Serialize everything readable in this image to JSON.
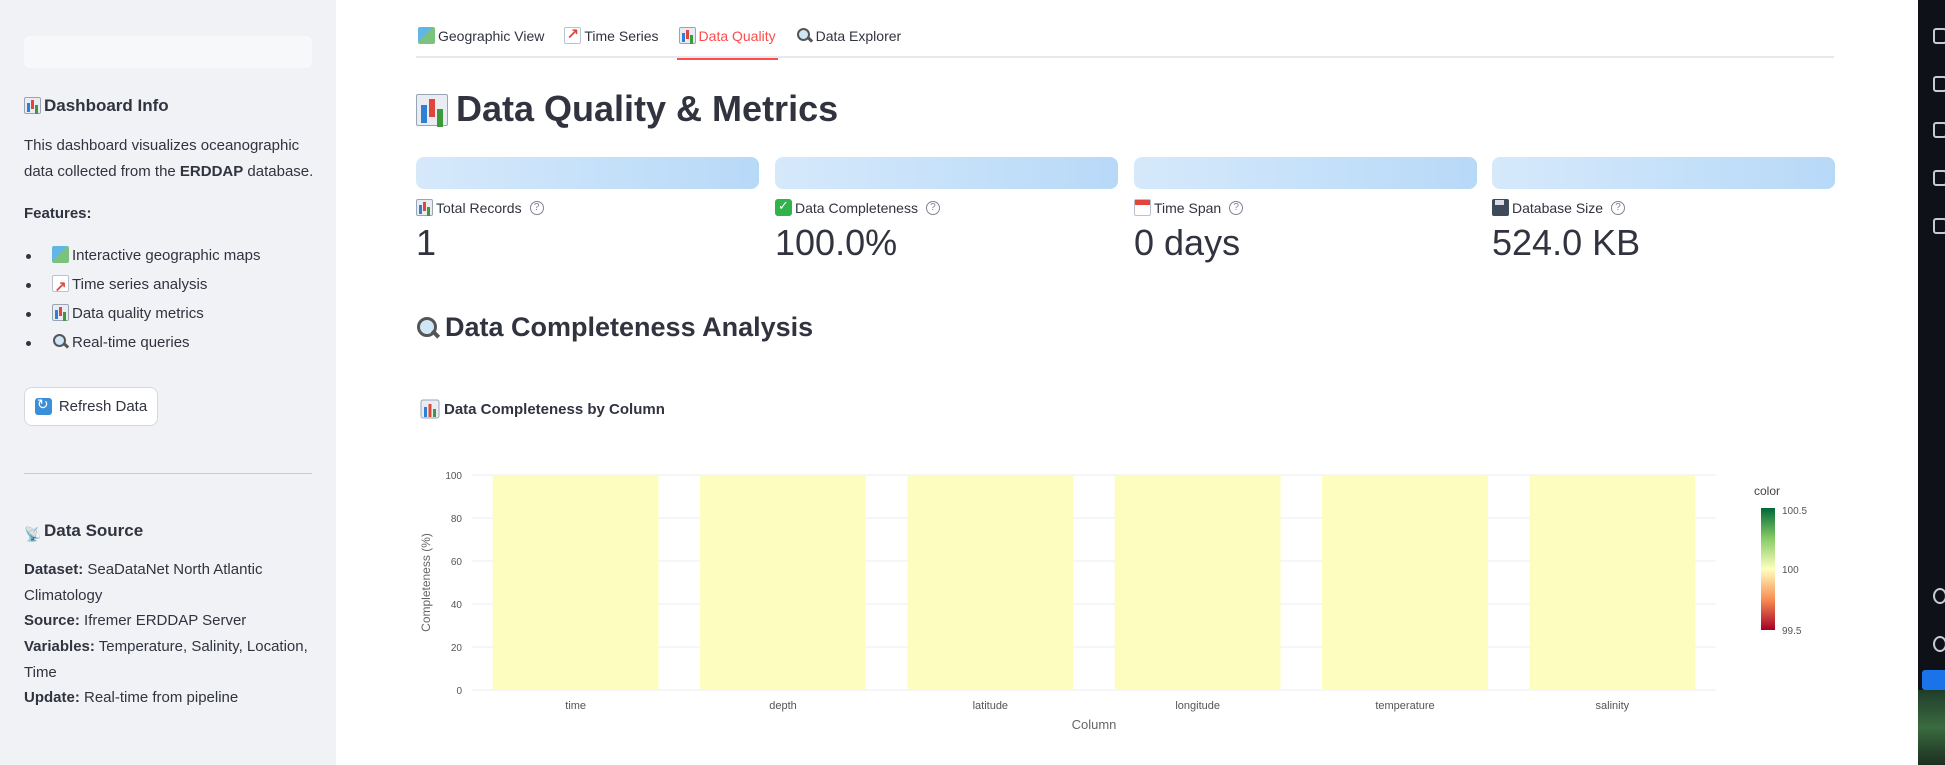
{
  "sidebar": {
    "info_title": "Dashboard Info",
    "info_text_1": "This dashboard visualizes oceanographic data collected from the ",
    "info_text_bold": "ERDDAP",
    "info_text_2": " database.",
    "features_label": "Features:",
    "features": [
      {
        "icon": "map-icon",
        "label": "Interactive geographic maps"
      },
      {
        "icon": "chart-increasing-icon",
        "label": "Time series analysis"
      },
      {
        "icon": "bar-chart-icon",
        "label": "Data quality metrics"
      },
      {
        "icon": "magnifier-icon",
        "label": "Real-time queries"
      }
    ],
    "refresh_button": "Refresh Data",
    "source_title": "Data Source",
    "source": {
      "dataset_label": "Dataset:",
      "dataset_value": " SeaDataNet North Atlantic Climatology",
      "source_label": "Source:",
      "source_value": " Ifremer ERDDAP Server",
      "variables_label": "Variables:",
      "variables_value": " Temperature, Salinity, Location, Time",
      "update_label": "Update:",
      "update_value": " Real-time from pipeline"
    }
  },
  "tabs": [
    {
      "icon": "map-icon",
      "label": "Geographic View",
      "active": false
    },
    {
      "icon": "chart-increasing-icon",
      "label": "Time Series",
      "active": false
    },
    {
      "icon": "bar-chart-icon",
      "label": "Data Quality",
      "active": true
    },
    {
      "icon": "magnifier-icon",
      "label": "Data Explorer",
      "active": false
    }
  ],
  "page_title": "Data Quality & Metrics",
  "metrics": [
    {
      "icon": "bar-chart-icon",
      "label": "Total Records",
      "value": "1"
    },
    {
      "icon": "check-mark-icon",
      "label": "Data Completeness",
      "value": "100.0%"
    },
    {
      "icon": "calendar-icon",
      "label": "Time Span",
      "value": "0 days"
    },
    {
      "icon": "floppy-disk-icon",
      "label": "Database Size",
      "value": "524.0 KB"
    }
  ],
  "section_title": "Data Completeness Analysis",
  "colors": {
    "accent": "#ff4b4b",
    "bar_fill": "#fefdc0",
    "metric_bar": "#c4e0fa",
    "scale_high": "#006837",
    "scale_mid": "#ffffbf",
    "scale_low": "#a50026"
  },
  "chart_data": {
    "type": "bar",
    "title": "Data Completeness by Column",
    "categories": [
      "time",
      "depth",
      "latitude",
      "longitude",
      "temperature",
      "salinity"
    ],
    "values": [
      100,
      100,
      100,
      100,
      100,
      100
    ],
    "xlabel": "Column",
    "ylabel": "Completeness (%)",
    "ylim": [
      0,
      100
    ],
    "yticks": [
      0,
      20,
      40,
      60,
      80,
      100
    ],
    "grid": true,
    "colorbar": {
      "title": "color",
      "ticks": [
        "100.5",
        "100",
        "99.5"
      ],
      "range": [
        99.5,
        100.5
      ]
    }
  }
}
